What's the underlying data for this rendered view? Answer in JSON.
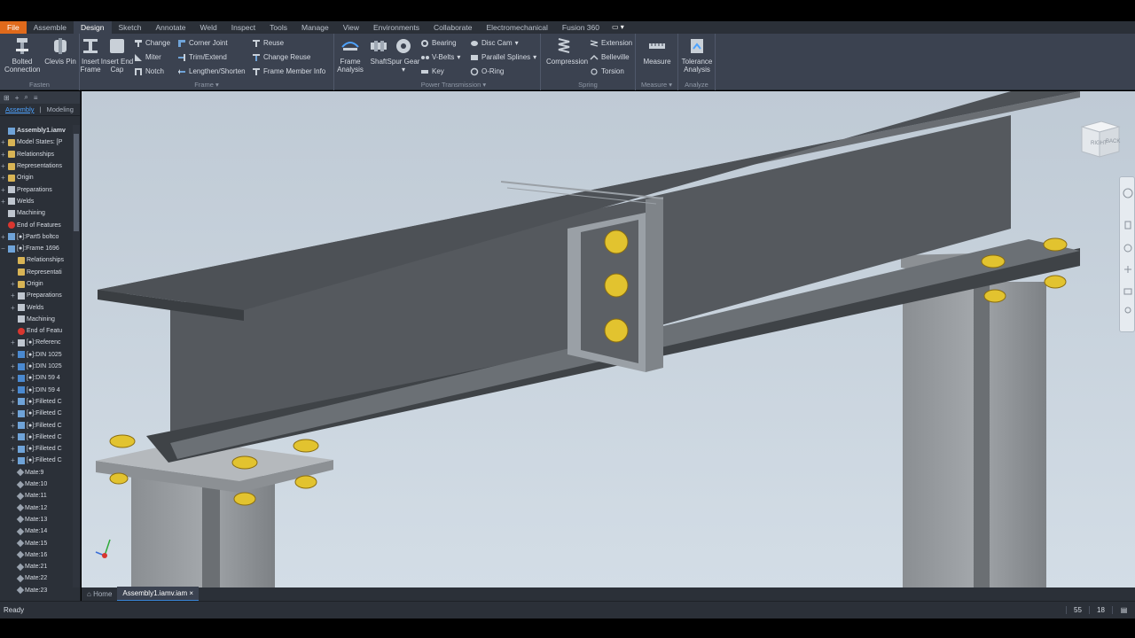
{
  "menubar": {
    "tabs": [
      "File",
      "Assemble",
      "Design",
      "Sketch",
      "Annotate",
      "Weld",
      "Inspect",
      "Tools",
      "Manage",
      "View",
      "Environments",
      "Collaborate",
      "Electromechanical",
      "Fusion 360"
    ],
    "active": "Design"
  },
  "ribbon": {
    "fasten": {
      "title": "Fasten",
      "bolted": "Bolted Connection",
      "clevis": "Clevis Pin"
    },
    "frame": {
      "title": "Frame",
      "insert_frame": "Insert Frame",
      "insert_end_cap": "Insert End Cap",
      "change": "Change",
      "miter": "Miter",
      "notch": "Notch",
      "corner_joint": "Corner Joint",
      "trim_extend": "Trim/Extend",
      "lengthen": "Lengthen/Shorten",
      "reuse": "Reuse",
      "change_reuse": "Change Reuse",
      "member_info": "Frame Member Info",
      "frame_analysis": "Frame Analysis"
    },
    "power": {
      "title": "Power Transmission",
      "shaft": "Shaft",
      "spur_gear": "Spur Gear",
      "bearing": "Bearing",
      "vbelts": "V-Belts",
      "key": "Key",
      "disc_cam": "Disc Cam",
      "parallel_splines": "Parallel Splines",
      "oring": "O-Ring"
    },
    "spring": {
      "title": "Spring",
      "compression": "Compression",
      "extension": "Extension",
      "belleville": "Belleville",
      "torsion": "Torsion"
    },
    "measure": {
      "title": "Measure",
      "measure": "Measure"
    },
    "analyze": {
      "title": "Analyze",
      "tolerance": "Tolerance Analysis"
    }
  },
  "browser": {
    "tab_assembly": "Assembly",
    "tab_modeling": "Modeling",
    "nodes": [
      {
        "label": "Assembly1.iamv",
        "icon": "part",
        "indent": 0,
        "exp": ""
      },
      {
        "label": "Model States: [P",
        "icon": "folder",
        "indent": 0,
        "exp": "+"
      },
      {
        "label": "Relationships",
        "icon": "folder",
        "indent": 0,
        "exp": "+"
      },
      {
        "label": "Representations",
        "icon": "folder",
        "indent": 0,
        "exp": "+"
      },
      {
        "label": "Origin",
        "icon": "folder",
        "indent": 0,
        "exp": "+"
      },
      {
        "label": "Preparations",
        "icon": "weld",
        "indent": 0,
        "exp": "+"
      },
      {
        "label": "Welds",
        "icon": "weld",
        "indent": 0,
        "exp": "+"
      },
      {
        "label": "Machining",
        "icon": "weld",
        "indent": 0,
        "exp": ""
      },
      {
        "label": "End of Features",
        "icon": "eof",
        "indent": 0,
        "exp": ""
      },
      {
        "label": "[●]:Part5 boltco",
        "icon": "part",
        "indent": 0,
        "exp": "+"
      },
      {
        "label": "[●]:Frame 1696",
        "icon": "part",
        "indent": 0,
        "exp": "−"
      },
      {
        "label": "Relationships",
        "icon": "folder",
        "indent": 1,
        "exp": ""
      },
      {
        "label": "Representati",
        "icon": "folder",
        "indent": 1,
        "exp": ""
      },
      {
        "label": "Origin",
        "icon": "folder",
        "indent": 1,
        "exp": "+"
      },
      {
        "label": "Preparations",
        "icon": "weld",
        "indent": 1,
        "exp": "+"
      },
      {
        "label": "Welds",
        "icon": "weld",
        "indent": 1,
        "exp": "+"
      },
      {
        "label": "Machining",
        "icon": "weld",
        "indent": 1,
        "exp": ""
      },
      {
        "label": "End of Featu",
        "icon": "eof",
        "indent": 1,
        "exp": ""
      },
      {
        "label": "[●]:Referenc",
        "icon": "weld",
        "indent": 1,
        "exp": "+"
      },
      {
        "label": "[●]:DIN 1025",
        "icon": "beam",
        "indent": 1,
        "exp": "+"
      },
      {
        "label": "[●]:DIN 1025",
        "icon": "beam",
        "indent": 1,
        "exp": "+"
      },
      {
        "label": "[●]:DIN 59 4",
        "icon": "beam",
        "indent": 1,
        "exp": "+"
      },
      {
        "label": "[●]:DIN 59 4",
        "icon": "beam",
        "indent": 1,
        "exp": "+"
      },
      {
        "label": "[●]:Filleted C",
        "icon": "part",
        "indent": 1,
        "exp": "+"
      },
      {
        "label": "[●]:Filleted C",
        "icon": "part",
        "indent": 1,
        "exp": "+"
      },
      {
        "label": "[●]:Filleted C",
        "icon": "part",
        "indent": 1,
        "exp": "+"
      },
      {
        "label": "[●]:Filleted C",
        "icon": "part",
        "indent": 1,
        "exp": "+"
      },
      {
        "label": "[●]:Filleted C",
        "icon": "part",
        "indent": 1,
        "exp": "+"
      },
      {
        "label": "[●]:Filleted C",
        "icon": "part",
        "indent": 1,
        "exp": "+"
      },
      {
        "label": "Mate:9",
        "icon": "mate",
        "indent": 1,
        "exp": ""
      },
      {
        "label": "Mate:10",
        "icon": "mate",
        "indent": 1,
        "exp": ""
      },
      {
        "label": "Mate:11",
        "icon": "mate",
        "indent": 1,
        "exp": ""
      },
      {
        "label": "Mate:12",
        "icon": "mate",
        "indent": 1,
        "exp": ""
      },
      {
        "label": "Mate:13",
        "icon": "mate",
        "indent": 1,
        "exp": ""
      },
      {
        "label": "Mate:14",
        "icon": "mate",
        "indent": 1,
        "exp": ""
      },
      {
        "label": "Mate:15",
        "icon": "mate",
        "indent": 1,
        "exp": ""
      },
      {
        "label": "Mate:16",
        "icon": "mate",
        "indent": 1,
        "exp": ""
      },
      {
        "label": "Mate:21",
        "icon": "mate",
        "indent": 1,
        "exp": ""
      },
      {
        "label": "Mate:22",
        "icon": "mate",
        "indent": 1,
        "exp": ""
      },
      {
        "label": "Mate:23",
        "icon": "mate",
        "indent": 1,
        "exp": ""
      }
    ]
  },
  "viewcube": {
    "right": "RIGHT",
    "back": "BACK"
  },
  "doctabs": {
    "home": "Home",
    "file": "Assembly1.iamv.iam"
  },
  "status": {
    "text": "Ready",
    "num1": "55",
    "num2": "18"
  },
  "colors": {
    "accent": "#3a86d6",
    "file_tab": "#e06a1b",
    "bolt": "#e2c32f",
    "beam": "#4e5359"
  }
}
